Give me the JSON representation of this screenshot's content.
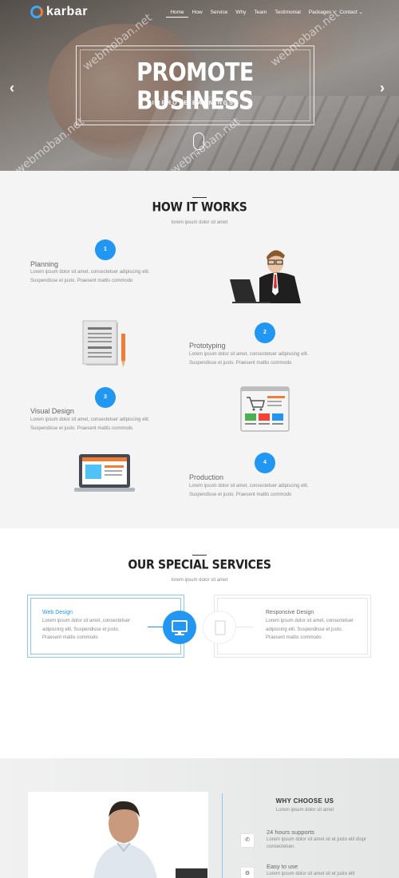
{
  "header": {
    "logo_text": "karbar",
    "nav": [
      "Home",
      "How",
      "Service",
      "Why",
      "Team",
      "Testimonial",
      "Packages",
      "Contact"
    ],
    "nav_active": "Home",
    "contact_chevron": "⌄"
  },
  "hero": {
    "title": "PROMOTE BUSINESS",
    "subtitle": "IMPROVE EARNINGS!",
    "prev_arrow": "‹",
    "next_arrow": "›",
    "scroll_chevron": "⌄",
    "watermark": "webmoban.net"
  },
  "how_it_works": {
    "title": "HOW IT WORKS",
    "subtitle": "lorem ipsum dolor sit amet",
    "steps": [
      {
        "num": "1",
        "title": "Planning",
        "desc": "Lorem ipsum dolor sit amet, consectetuer adipiscing elit. Suspendisse et justo. Praesent mattis commodo"
      },
      {
        "num": "2",
        "title": "Prototyping",
        "desc": "Lorem ipsum dolor sit amet, consectetuer adipiscing elit. Suspendisse et justo. Praesent mattis commodo"
      },
      {
        "num": "3",
        "title": "Visual Design",
        "desc": "Lorem ipsum dolor sit amet, consectetuer adipiscing elit. Suspendisse et justo. Praesent mattis commodo"
      },
      {
        "num": "4",
        "title": "Production",
        "desc": "Lorem ipsum dolor sit amet, consectetuer adipiscing elit. Suspendisse et justo. Praesent mattis commodo"
      }
    ]
  },
  "services": {
    "title": "OUR SPECIAL SERVICES",
    "subtitle": "lorem ipsum dolor sit amet",
    "items": [
      {
        "title": "Web Design",
        "desc": "Lorem ipsum dolor sit amet, consectetuer adipiscing elit. Suspendisse et justo. Praesent mattis commodo",
        "icon": "monitor-icon"
      },
      {
        "title": "Responsive Design",
        "desc": "Lorem ipsum dolor sit amet, consectetuer adipiscing elit. Suspendisse et justo. Praesent mattis commodo",
        "icon": "tablet-icon"
      }
    ]
  },
  "why": {
    "title": "WHY CHOOSE US",
    "subtitle": "Lorem ipsum dolor sit amet",
    "items": [
      {
        "icon": "phone-icon",
        "glyph": "✆",
        "title": "24 hours supports",
        "desc": "Lorem ipsum dolor sit amet sit et justo elit dispr consectetuer."
      },
      {
        "icon": "settings-icon",
        "glyph": "⚙",
        "title": "Easy to use",
        "desc": "Lorem ipsum dolor sit amet sit et justo elit"
      }
    ]
  },
  "colors": {
    "accent": "#2196f3",
    "orange": "#f27b35",
    "light_bg": "#f4f4f4"
  }
}
